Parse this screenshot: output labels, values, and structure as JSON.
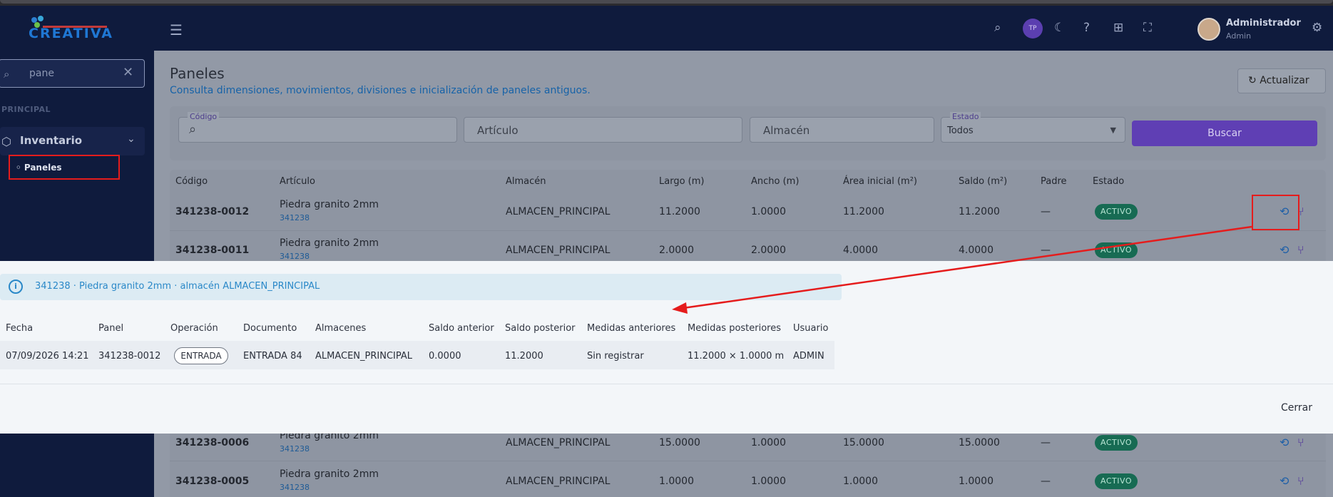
{
  "app": {
    "logo_text": "CREATIVA"
  },
  "sidebar": {
    "search_value": "pane",
    "section_label": "PRINCIPAL",
    "menu_label": "Inventario",
    "submenu_label": "Paneles"
  },
  "header": {
    "avatar_initials": "TP",
    "user_name": "Administrador",
    "user_role": "Admin",
    "icons": [
      "search-icon",
      "moon-icon",
      "help-icon",
      "apps-icon",
      "fullscreen-icon",
      "gear-icon"
    ]
  },
  "page": {
    "title": "Paneles",
    "subtitle": "Consulta dimensiones, movimientos, divisiones e inicialización de paneles antiguos.",
    "refresh_label": "Actualizar"
  },
  "filters": {
    "codigo_label": "Código",
    "articulo_placeholder": "Artículo",
    "almacen_placeholder": "Almacén",
    "estado_label": "Estado",
    "estado_value": "Todos",
    "search_button": "Buscar"
  },
  "table": {
    "columns": [
      "Código",
      "Artículo",
      "Almacén",
      "Largo (m)",
      "Ancho (m)",
      "Área inicial (m²)",
      "Saldo (m²)",
      "Padre",
      "Estado"
    ],
    "rows": [
      {
        "codigo": "341238-0012",
        "articulo": "Piedra granito 2mm",
        "articulo_codigo": "341238",
        "almacen": "ALMACEN_PRINCIPAL",
        "largo": "11.2000",
        "ancho": "1.0000",
        "area": "11.2000",
        "saldo": "11.2000",
        "padre": "—",
        "estado": "ACTIVO"
      },
      {
        "codigo": "341238-0011",
        "articulo": "Piedra granito 2mm",
        "articulo_codigo": "341238",
        "almacen": "ALMACEN_PRINCIPAL",
        "largo": "2.0000",
        "ancho": "2.0000",
        "area": "4.0000",
        "saldo": "4.0000",
        "padre": "—",
        "estado": "ACTIVO"
      },
      {
        "codigo": "341238-0006",
        "articulo": "Piedra granito 2mm",
        "articulo_codigo": "341238",
        "almacen": "ALMACEN_PRINCIPAL",
        "largo": "15.0000",
        "ancho": "1.0000",
        "area": "15.0000",
        "saldo": "15.0000",
        "padre": "—",
        "estado": "ACTIVO"
      },
      {
        "codigo": "341238-0005",
        "articulo": "Piedra granito 2mm",
        "articulo_codigo": "341238",
        "almacen": "ALMACEN_PRINCIPAL",
        "largo": "1.0000",
        "ancho": "1.0000",
        "area": "1.0000",
        "saldo": "1.0000",
        "padre": "—",
        "estado": "ACTIVO"
      }
    ]
  },
  "modal": {
    "info_text": "341238 · Piedra granito 2mm · almacén ALMACEN_PRINCIPAL",
    "columns": [
      "Fecha",
      "Panel",
      "Operación",
      "Documento",
      "Almacenes",
      "Saldo anterior",
      "Saldo posterior",
      "Medidas anteriores",
      "Medidas posteriores",
      "Usuario"
    ],
    "row": {
      "fecha": "07/09/2026 14:21",
      "panel": "341238-0012",
      "operacion": "ENTRADA",
      "documento": "ENTRADA 84",
      "almacenes": "ALMACEN_PRINCIPAL",
      "saldo_anterior": "0.0000",
      "saldo_posterior": "11.2000",
      "medidas_anteriores": "Sin registrar",
      "medidas_posteriores": "11.2000 × 1.0000 m",
      "usuario": "ADMIN"
    },
    "close_label": "Cerrar"
  },
  "colors": {
    "sidebar_bg": "#0f1b3d",
    "accent_purple": "#5f3fb4",
    "badge_green": "#176b53",
    "annotation_red": "#e51c1c",
    "info_blue": "#2a88c8"
  }
}
